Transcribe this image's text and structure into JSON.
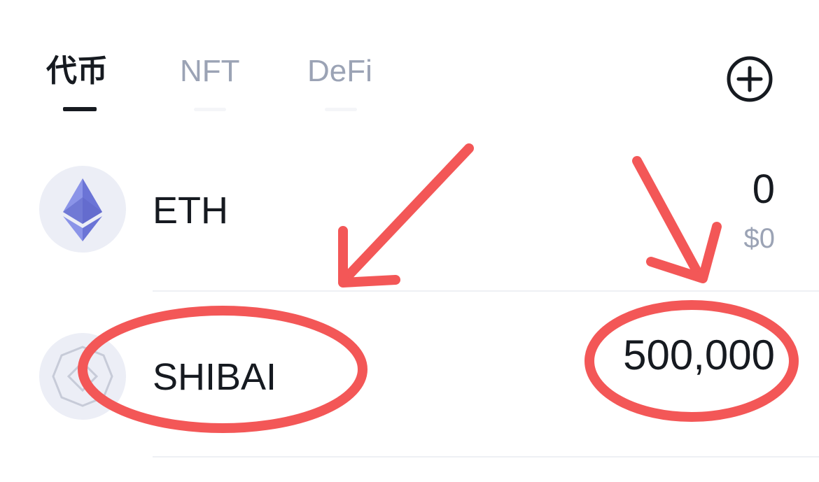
{
  "tabs": [
    {
      "label": "代币",
      "active": true
    },
    {
      "label": "NFT",
      "active": false
    },
    {
      "label": "DeFi",
      "active": false
    }
  ],
  "add_button": {
    "icon": "plus-circle-icon"
  },
  "tokens": [
    {
      "symbol": "ETH",
      "icon": "ethereum-icon",
      "amount": "0",
      "fiat": "$0"
    },
    {
      "symbol": "SHIBAI",
      "icon": "shib-placeholder-icon",
      "amount": "500,000"
    }
  ],
  "colors": {
    "text_primary": "#161a20",
    "text_secondary": "#9ba3b5",
    "icon_bg": "#eceef6",
    "eth_purple": "#7b84e0",
    "annotation_red": "#f35757"
  }
}
